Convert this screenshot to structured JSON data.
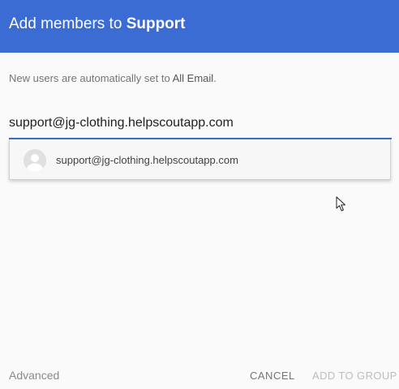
{
  "header": {
    "title_prefix": "Add members to",
    "group_name": "Support",
    "background_color": "#3b6cd3"
  },
  "hint": {
    "prefix": "New users are automatically set to",
    "value": "All Email",
    "suffix": "."
  },
  "email_input": {
    "value": "support@jg-clothing.helpscoutapp.com"
  },
  "suggestions": [
    {
      "label": "support@jg-clothing.helpscoutapp.com",
      "icon": "default-avatar-icon"
    }
  ],
  "footer": {
    "advanced_label": "Advanced",
    "cancel_label": "CANCEL",
    "add_label": "ADD TO GROUP"
  }
}
